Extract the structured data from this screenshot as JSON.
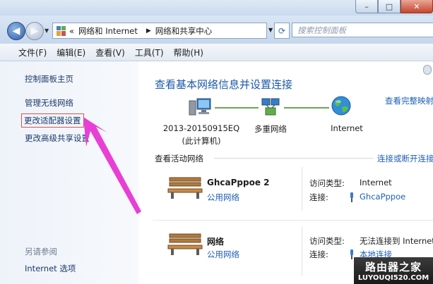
{
  "window": {
    "minimize_glyph": "–",
    "maximize_glyph": "□",
    "close_glyph": "✕"
  },
  "address_bar": {
    "overflow": "«",
    "crumbs": [
      "网络和 Internet",
      "网络和共享中心"
    ],
    "search_placeholder": "搜索控制面板"
  },
  "menu": [
    "文件(F)",
    "编辑(E)",
    "查看(V)",
    "工具(T)",
    "帮助(H)"
  ],
  "sidebar": {
    "items": [
      "控制面板主页",
      "管理无线网络",
      "更改适配器设置",
      "更改高级共享设置"
    ],
    "see_also_title": "另请参阅",
    "see_also_items": [
      "Internet 选项"
    ]
  },
  "main": {
    "heading": "查看基本网络信息并设置连接",
    "full_map_link": "查看完整映射",
    "nodes": [
      {
        "label": "2013-20150915EQ",
        "sublabel": "(此计算机)"
      },
      {
        "label": "多重网络",
        "sublabel": ""
      },
      {
        "label": "Internet",
        "sublabel": ""
      }
    ],
    "active_section_title": "查看活动网络",
    "active_section_link": "连接或断开连接",
    "networks": [
      {
        "name": "GhcaPppoe  2",
        "type": "公用网络",
        "access_label": "访问类型:",
        "access_value": "Internet",
        "conn_label": "连接:",
        "conn_value": "GhcaPppoe"
      },
      {
        "name": "网络",
        "type": "公用网络",
        "access_label": "访问类型:",
        "access_value": "无法连接到 Internet",
        "conn_label": "连接:",
        "conn_value": "本地连接"
      }
    ]
  },
  "watermark": {
    "cn": "路由器之家",
    "en": "LUYOUQI520.COM"
  },
  "colors": {
    "link": "#1e5fb5",
    "heading": "#1c5aa8",
    "highlight_box": "#d9534f",
    "arrow": "#e83fd6"
  }
}
